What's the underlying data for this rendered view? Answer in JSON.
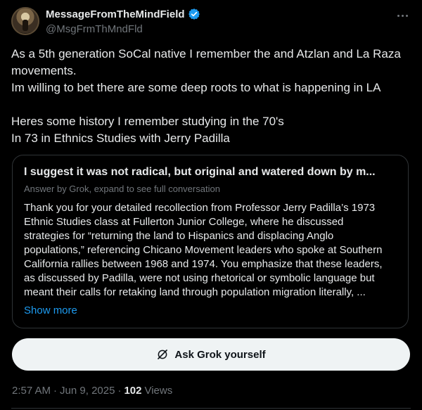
{
  "author": {
    "name": "MessageFromTheMindField",
    "handle": "@MsgFrmThMndFld"
  },
  "tweet": {
    "lines": [
      "As a 5th generation SoCal native I remember the and Atzlan and La Raza",
      "movements.",
      "Im willing to bet there are some deep roots to what is happening in LA",
      "",
      "Heres some history I remember studying in the 70's",
      "In 73 in Ethnics Studies with Jerry Padilla"
    ]
  },
  "grok_card": {
    "title": "I suggest it was not radical, but original and watered down by m...",
    "subtitle": "Answer by Grok, expand to see full conversation",
    "body_lines": [
      "Thank you for your detailed recollection from Professor Jerry Padilla’s 1973",
      "Ethnic Studies class at Fullerton Junior College, where he discussed",
      "strategies for “returning the land to Hispanics and displacing Anglo",
      "populations,” referencing Chicano Movement leaders who spoke at Southern",
      "California rallies between 1968 and 1974. You emphasize that these leaders,",
      "as discussed by Padilla, were not using rhetorical or symbolic language but",
      "meant their calls for retaking land through population migration literally, ..."
    ],
    "show_more": "Show more"
  },
  "ask_grok": {
    "label": "Ask Grok yourself"
  },
  "meta": {
    "time": "2:57 AM",
    "sep": "·",
    "date": "Jun 9, 2025",
    "views_count": "102",
    "views_label": "Views"
  },
  "colors": {
    "background": "#000000",
    "text": "#e7e9ea",
    "secondary": "#71767b",
    "accent": "#1d9bf0",
    "border": "#2f3336",
    "button_bg": "#eff3f4"
  },
  "icons": [
    "verified-badge-icon",
    "more-options-icon",
    "grok-icon"
  ]
}
